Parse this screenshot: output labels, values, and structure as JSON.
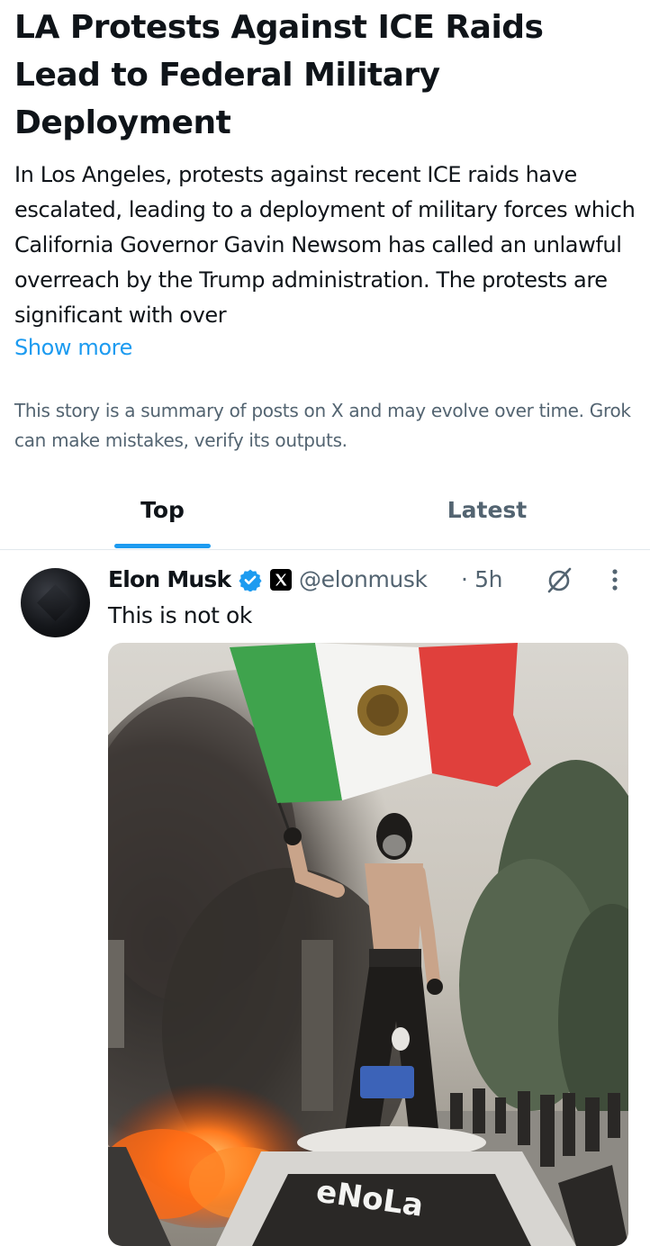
{
  "story": {
    "title": "LA Protests Against ICE Raids Lead to Federal Military Deployment",
    "summary": "In Los Angeles, protests against recent ICE raids have escalated, leading to a deployment of military forces which California Governor Gavin Newsom has called an unlawful overreach by the Trump administration. The protests are significant with over",
    "show_more_label": "Show more",
    "disclaimer": "This story is a summary of posts on X and may evolve over time. Grok can make mistakes, verify its outputs."
  },
  "tabs": [
    {
      "label": "Top",
      "active": true
    },
    {
      "label": "Latest",
      "active": false
    }
  ],
  "post": {
    "author_name": "Elon Musk",
    "handle": "@elonmusk",
    "timestamp": "· 5h",
    "text": "This is not ok",
    "verified_icon": "verified-badge-icon",
    "affiliate_icon": "x-logo-icon",
    "actions": [
      "grok-icon",
      "more-icon"
    ],
    "media_text": "eNoLa"
  },
  "colors": {
    "accent": "#1d9bf0",
    "text_primary": "#0f1419",
    "text_secondary": "#536471",
    "divider": "#e1e8ed"
  }
}
